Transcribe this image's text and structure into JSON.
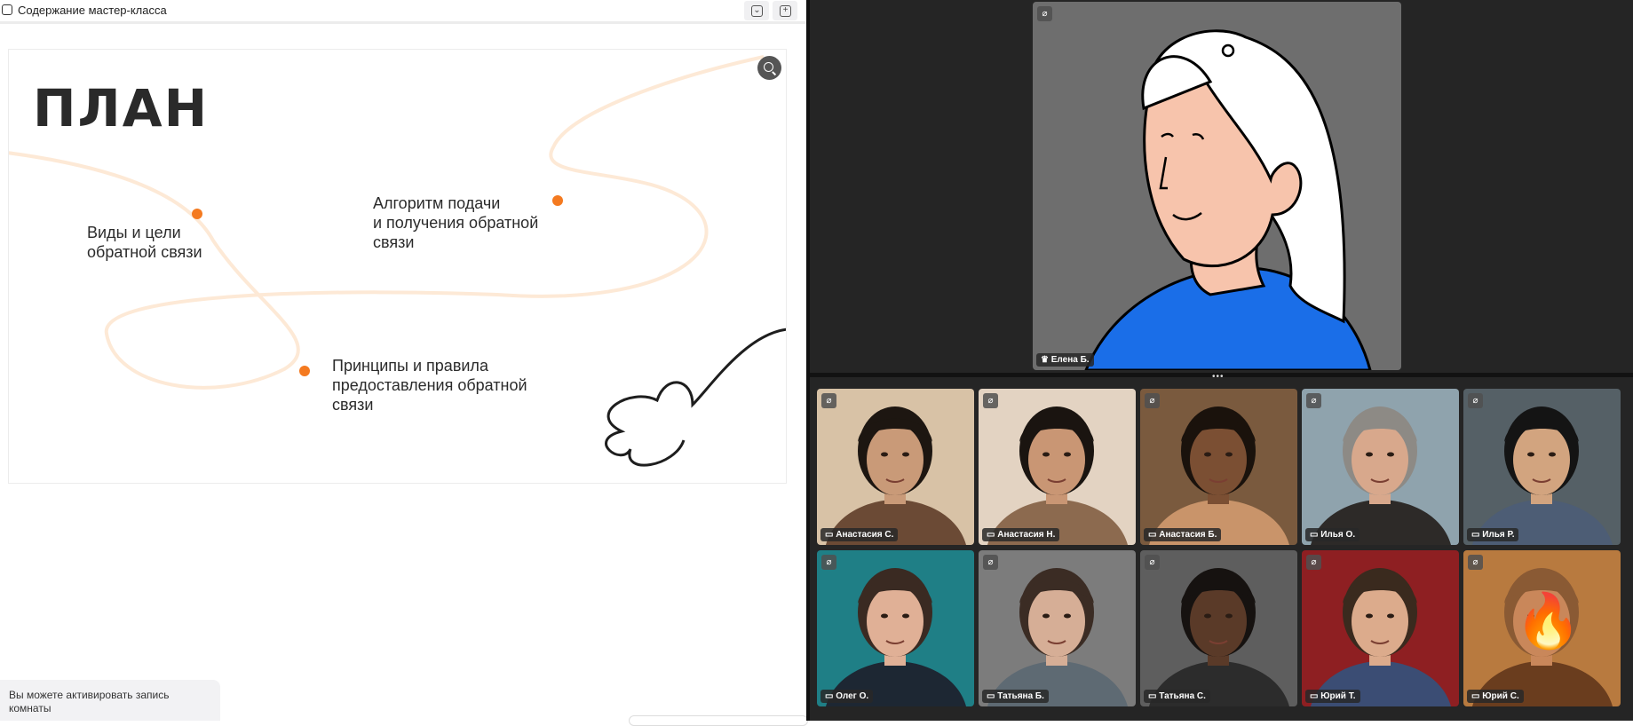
{
  "window": {
    "title": "Содержание мастер-класса"
  },
  "slide": {
    "heading": "ПЛАН",
    "items": [
      "Виды и цели\nобратной связи",
      "Алгоритм подачи\nи получения обратной\nсвязи",
      "Принципы и правила\nпредоставления обратной\nсвязи"
    ],
    "accent_color": "#f47a20"
  },
  "notice": {
    "text": "Вы можете активировать запись комнаты"
  },
  "speaker": {
    "name": "Елена Б.",
    "badge_icon": "crown-icon"
  },
  "participants": [
    {
      "name": "Анастасия С.",
      "bg": "#d8c2a6",
      "skin": "#c99a78",
      "hair": "#1d1611",
      "shirt": "#6b4a35"
    },
    {
      "name": "Анастасия Н.",
      "bg": "#e3d3c2",
      "skin": "#c99674",
      "hair": "#1a1410",
      "shirt": "#8c6a4f"
    },
    {
      "name": "Анастасия Б.",
      "bg": "#7a5a3e",
      "skin": "#7b4f33",
      "hair": "#1a120c",
      "shirt": "#c9946a"
    },
    {
      "name": "Илья О.",
      "bg": "#8fa3ad",
      "skin": "#d8a88c",
      "hair": "#8d8a85",
      "shirt": "#2d2a28"
    },
    {
      "name": "Илья Р.",
      "bg": "#556066",
      "skin": "#d2a47f",
      "hair": "#141414",
      "shirt": "#4d5d75"
    },
    {
      "name": "Олег О.",
      "bg": "#1f7f86",
      "skin": "#e0b096",
      "hair": "#3a2a22",
      "shirt": "#1d2733"
    },
    {
      "name": "Татьяна Б.",
      "bg": "#7c7c7c",
      "skin": "#d6ae96",
      "hair": "#3b2c24",
      "shirt": "#5e6a73"
    },
    {
      "name": "Татьяна С.",
      "bg": "#5e5e5e",
      "skin": "#5a3a28",
      "hair": "#161210",
      "shirt": "#2c2c2c"
    },
    {
      "name": "Юрий Т.",
      "bg": "#8e1f22",
      "skin": "#dcab8c",
      "hair": "#3a2a1e",
      "shirt": "#3b4d74"
    },
    {
      "name": "Юрий С.",
      "bg": "#b87a3f",
      "skin": "#c9875a",
      "hair": "#8a5a34",
      "shirt": "#6a3d1e",
      "reaction_icon": "fire-icon"
    }
  ]
}
